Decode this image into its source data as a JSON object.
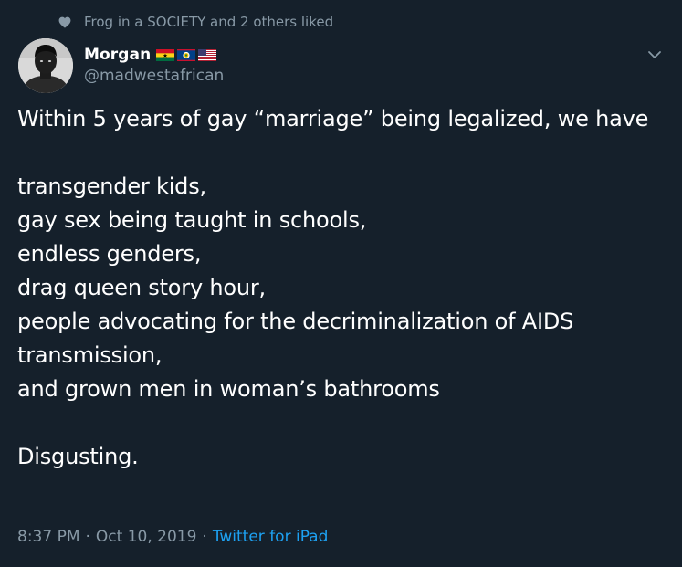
{
  "social_context": {
    "icon": "heart-icon",
    "text": "Frog in a SOCIETY and 2 others liked"
  },
  "author": {
    "display_name": "Morgan",
    "handle": "@madwestafrican",
    "flags": [
      "ghana-flag-icon",
      "belize-flag-icon",
      "us-flag-icon"
    ]
  },
  "tweet": {
    "text": "Within 5 years of gay “marriage” being legalized, we have\n\ntransgender kids,\ngay sex being taught in schools,\nendless genders,\ndrag queen story hour,\npeople advocating for the decriminalization of AIDS transmission,\nand grown men in woman’s bathrooms\n\nDisgusting."
  },
  "meta": {
    "time": "8:37 PM",
    "separator": "·",
    "date": "Oct 10, 2019",
    "source": "Twitter for iPad"
  },
  "colors": {
    "background": "#15202b",
    "text": "#ffffff",
    "secondary": "#8899a6",
    "link": "#1da1f2"
  }
}
